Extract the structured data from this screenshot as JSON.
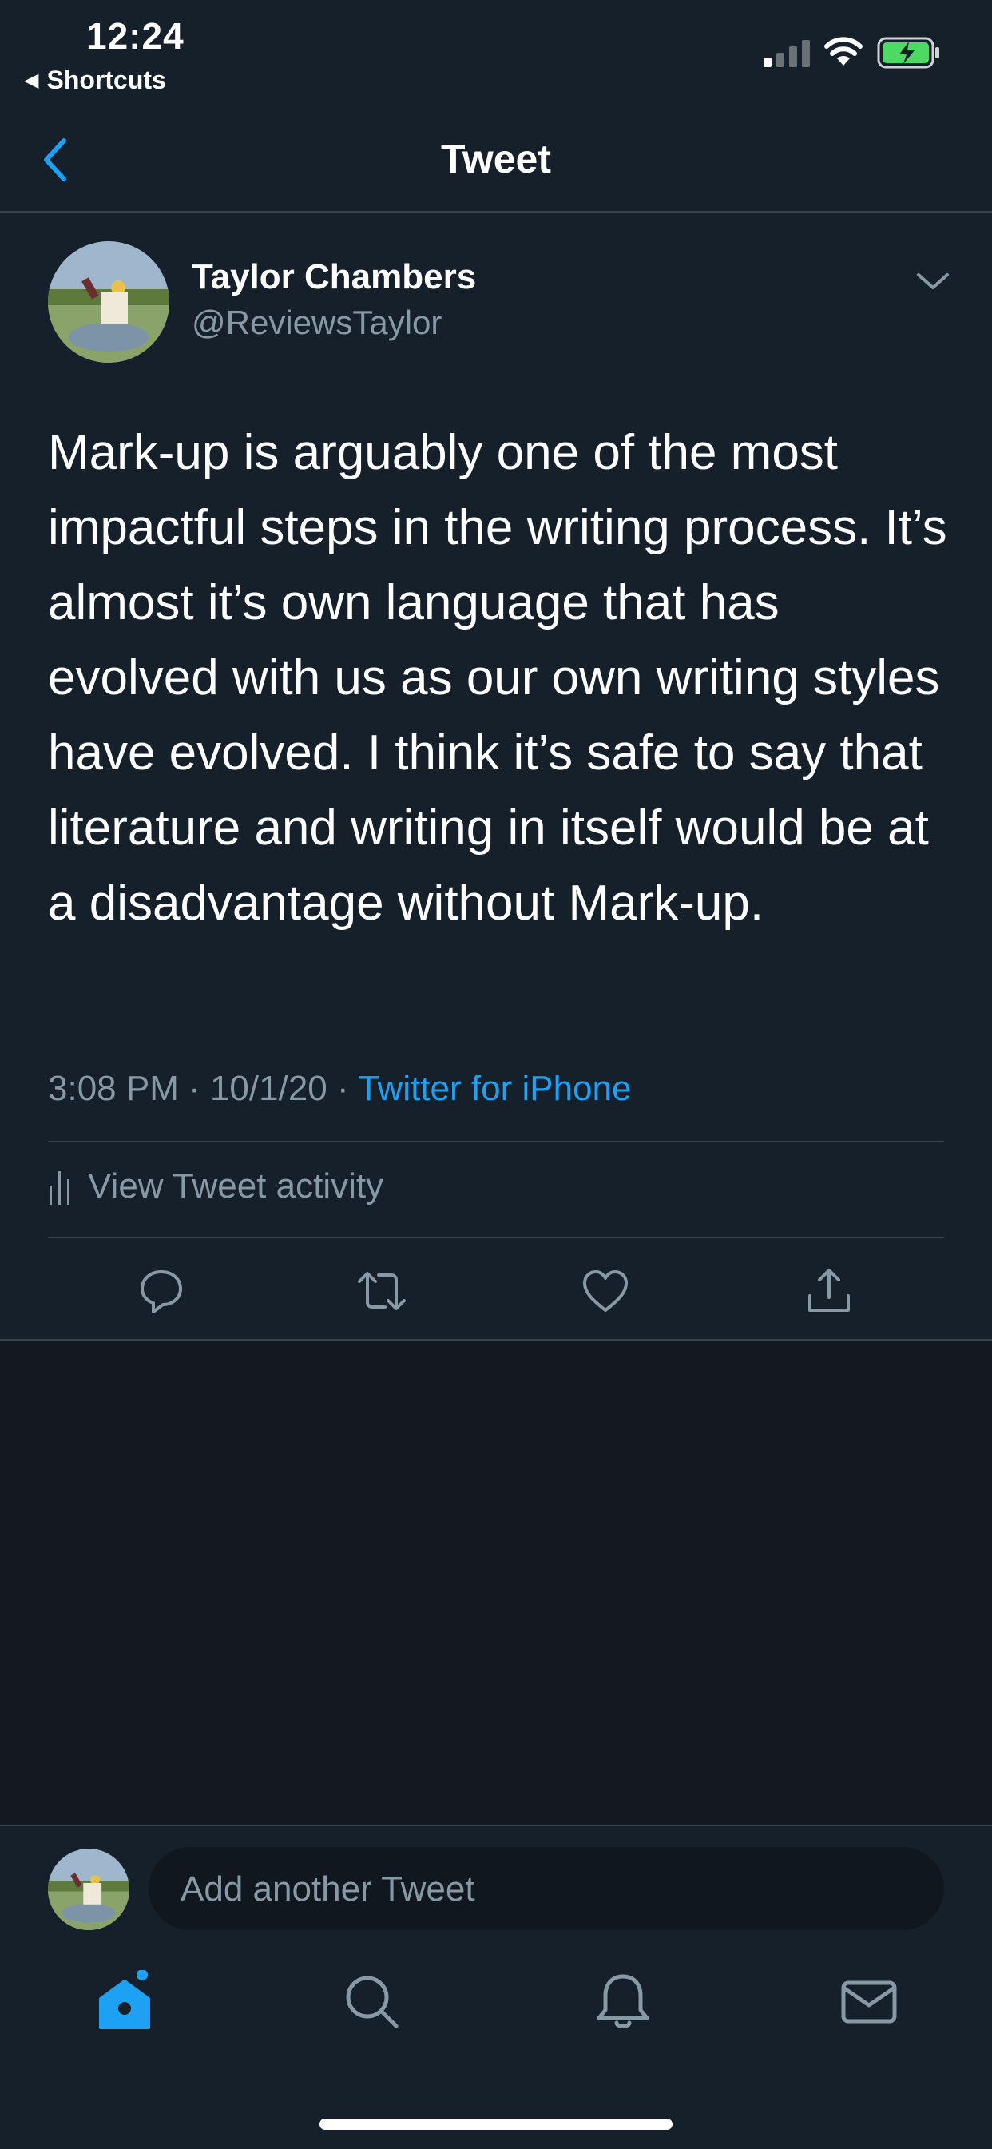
{
  "status_bar": {
    "time": "12:24",
    "back_app": "Shortcuts"
  },
  "nav": {
    "title": "Tweet",
    "back_icon": "chevron-left-icon"
  },
  "tweet": {
    "author_name": "Taylor Chambers",
    "author_handle": "@ReviewsTaylor",
    "text": "Mark-up is arguably one of the most impactful steps in the writing process. It’s almost it’s own language that has evolved with us as our own writing styles have evolved. I think it’s safe to say that literature and writing in itself would be at a disadvantage without Mark-up.",
    "time": "3:08 PM · 10/1/20 · ",
    "source": "Twitter for iPhone",
    "activity_label": "View Tweet activity"
  },
  "reply": {
    "placeholder": "Add another Tweet"
  },
  "tabs": [
    "home-icon",
    "search-icon",
    "bell-icon",
    "mail-icon"
  ],
  "colors": {
    "accent": "#1da1f2",
    "background": "#15202b",
    "secondary_text": "#8899a6",
    "battery_green": "#4cd964"
  }
}
